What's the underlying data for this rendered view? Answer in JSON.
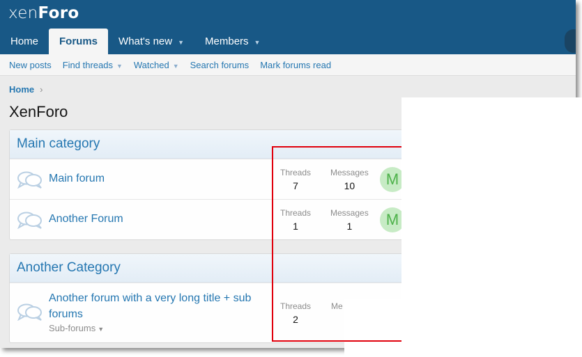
{
  "header": {
    "logo_part1": "xen",
    "logo_part2": "Foro"
  },
  "nav": {
    "tabs": [
      {
        "label": "Home"
      },
      {
        "label": "Forums",
        "active": true
      },
      {
        "label": "What's new",
        "has_menu": true
      },
      {
        "label": "Members",
        "has_menu": true
      }
    ]
  },
  "subnav": {
    "items": [
      {
        "label": "New posts"
      },
      {
        "label": "Find threads",
        "has_menu": true
      },
      {
        "label": "Watched",
        "has_menu": true
      },
      {
        "label": "Search forums"
      },
      {
        "label": "Mark forums read"
      }
    ]
  },
  "breadcrumb": {
    "home": "Home"
  },
  "page_title": "XenForo",
  "categories": [
    {
      "title": "Main category",
      "forums": [
        {
          "title": "Main forum",
          "threads_label": "Threads",
          "threads": "7",
          "messages_label": "Messages",
          "messages": "10",
          "avatar_letter": "M"
        },
        {
          "title": "Another Forum",
          "threads_label": "Threads",
          "threads": "1",
          "messages_label": "Messages",
          "messages": "1",
          "avatar_letter": "M"
        }
      ]
    },
    {
      "title": "Another Category",
      "forums": [
        {
          "title": "Another forum with a very long title + sub forums",
          "subforums_label": "Sub-forums",
          "threads_label": "Threads",
          "threads": "2",
          "messages_label": "Me"
        }
      ]
    }
  ],
  "colors": {
    "header_bg": "#185886",
    "link": "#2577b1",
    "highlight": "#e0000c",
    "avatar_bg": "#c7ebc5"
  },
  "icons": {
    "forum": "forum-chat-bubbles-icon",
    "caret": "caret-down-icon",
    "chevron": "chevron-right-icon"
  }
}
